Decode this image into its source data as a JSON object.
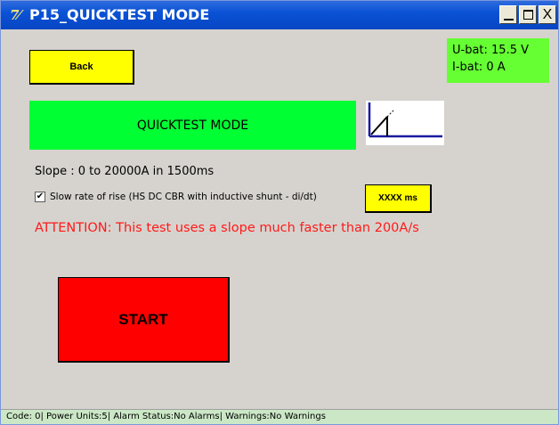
{
  "window": {
    "title": "P15_QUICKTEST MODE",
    "app_icon_glyph": "7⁄",
    "minimize_label": "_",
    "maximize_label": "□",
    "close_label": "X"
  },
  "battery": {
    "voltage": "U-bat: 15.5 V",
    "current": "I-bat: 0 A"
  },
  "back_button": {
    "label": "Back"
  },
  "mode_banner": {
    "label": "QUICKTEST MODE"
  },
  "slope_icon": {
    "icon": "ramp-slope-icon"
  },
  "slope_text": "Slope : 0 to 20000A in 1500ms",
  "slow_rate": {
    "checked": true,
    "label": "Slow rate of rise (HS DC CBR with inductive shunt - di/dt)",
    "ms_button_label": "XXXX ms"
  },
  "attention_text": "ATTENTION: This test uses a slope much faster than 200A/s",
  "start_button": {
    "label": "START"
  },
  "status_bar": "Code: 0| Power Units:5| Alarm Status:No Alarms| Warnings:No Warnings",
  "colors": {
    "titlebar": "#0a52d6",
    "window_bg": "#d6d3ce",
    "battery_bg": "#66ff33",
    "button_yellow": "#ffff00",
    "banner_green": "#00ff33",
    "start_red": "#ff0000",
    "attention_red": "#ff1a1a",
    "statusbar_bg": "#cbe7c6"
  }
}
